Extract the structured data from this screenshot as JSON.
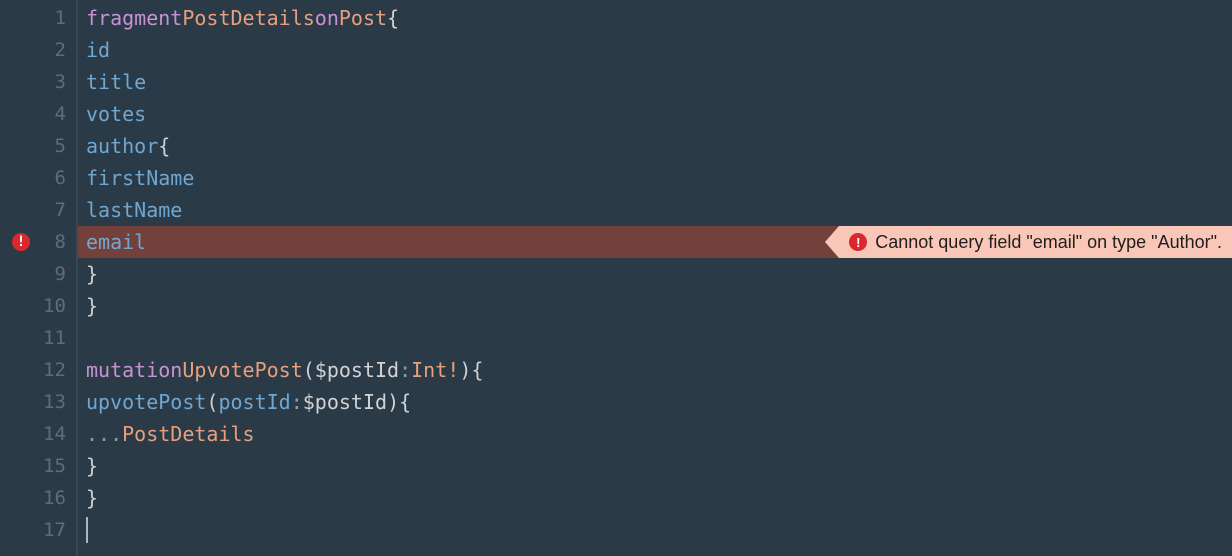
{
  "lineNumbers": [
    "1",
    "2",
    "3",
    "4",
    "5",
    "6",
    "7",
    "8",
    "9",
    "10",
    "11",
    "12",
    "13",
    "14",
    "15",
    "16",
    "17"
  ],
  "errorLine": 8,
  "errorTooltip": "Cannot query field \"email\" on type \"Author\".",
  "tokens": {
    "fragment": "fragment",
    "postDetails": "PostDetails",
    "on": "on",
    "post": "Post",
    "id": "id",
    "title": "title",
    "votes": "votes",
    "author": "author",
    "firstName": "firstName",
    "lastName": "lastName",
    "email": "email",
    "mutation": "mutation",
    "upvotePostType": "UpvotePost",
    "dollarPostId": "$postId",
    "colon": ":",
    "intBang": "Int!",
    "upvotePost": "upvotePost",
    "postId": "postId",
    "spread": "...",
    "lbrace": "{",
    "rbrace": "}",
    "lparen": "(",
    "rparen": ")"
  }
}
